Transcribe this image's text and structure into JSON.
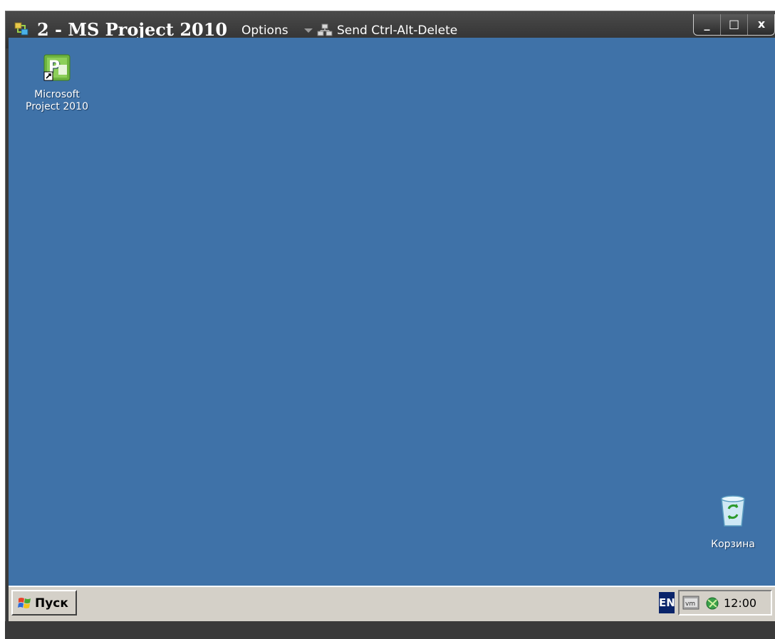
{
  "window": {
    "title": "2 - MS Project 2010",
    "options_label": "Options",
    "send_cad_label": "Send Ctrl-Alt-Delete",
    "controls": {
      "minimize": "_",
      "maximize": "□",
      "close": "x"
    }
  },
  "desktop": {
    "background_color": "#3f72a8",
    "icons": [
      {
        "label_line1": "Microsoft",
        "label_line2": "Project 2010",
        "icon": "ms-project-icon"
      },
      {
        "label_line1": "Корзина",
        "icon": "recycle-bin-icon"
      }
    ]
  },
  "taskbar": {
    "start_label": "Пуск",
    "language": "EN",
    "clock": "12:00",
    "tray_icons": [
      "vmware-tools-icon",
      "network-icon"
    ]
  }
}
